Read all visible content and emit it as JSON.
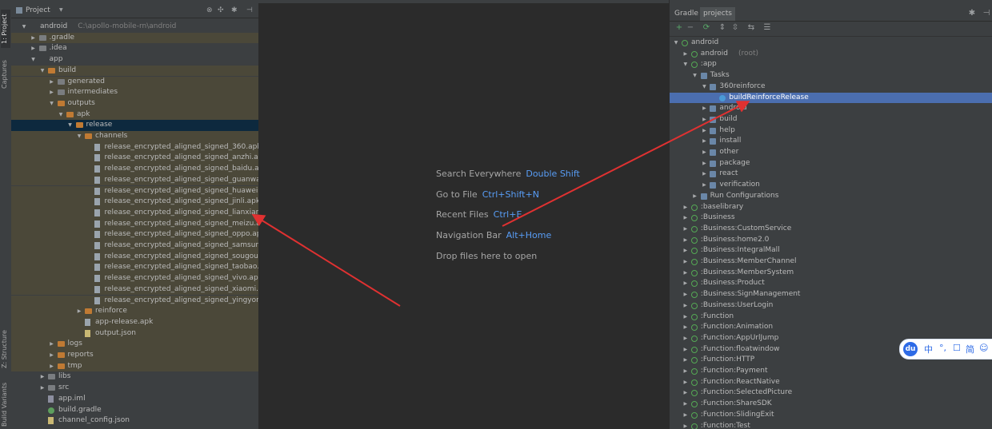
{
  "left_strip": {
    "tabs": [
      "1: Project",
      "Captures",
      "Z: Structure",
      "Build Variants"
    ]
  },
  "project_panel": {
    "title": "Project",
    "toolbar_icons": [
      "target-icon",
      "collapse-icon",
      "gear-icon",
      "hide-icon"
    ],
    "tree": [
      {
        "depth": 0,
        "expanded": true,
        "icon": "module",
        "label": "android",
        "sub": "C:\\apollo-mobile-rn\\android"
      },
      {
        "depth": 1,
        "expanded": false,
        "icon": "folder",
        "label": ".gradle",
        "state": "tan"
      },
      {
        "depth": 1,
        "expanded": false,
        "icon": "folder",
        "label": ".idea"
      },
      {
        "depth": 1,
        "expanded": true,
        "icon": "module",
        "label": "app"
      },
      {
        "depth": 2,
        "expanded": true,
        "icon": "ofolder",
        "label": "build",
        "state": "tan"
      },
      {
        "depth": 3,
        "expanded": false,
        "icon": "folder",
        "label": "generated",
        "state": "tan"
      },
      {
        "depth": 3,
        "expanded": false,
        "icon": "folder",
        "label": "intermediates",
        "state": "tan"
      },
      {
        "depth": 3,
        "expanded": true,
        "icon": "ofolder",
        "label": "outputs",
        "state": "tan"
      },
      {
        "depth": 4,
        "expanded": true,
        "icon": "ofolder",
        "label": "apk",
        "state": "tan"
      },
      {
        "depth": 5,
        "expanded": true,
        "icon": "ofolder",
        "label": "release",
        "state": "selected"
      },
      {
        "depth": 6,
        "expanded": true,
        "icon": "ofolder",
        "label": "channels",
        "state": "tan"
      },
      {
        "depth": 7,
        "icon": "file",
        "label": "release_encrypted_aligned_signed_360.apk",
        "state": "tan"
      },
      {
        "depth": 7,
        "icon": "file",
        "label": "release_encrypted_aligned_signed_anzhi.apk",
        "state": "tan"
      },
      {
        "depth": 7,
        "icon": "file",
        "label": "release_encrypted_aligned_signed_baidu.apk",
        "state": "tan"
      },
      {
        "depth": 7,
        "icon": "file",
        "label": "release_encrypted_aligned_signed_guanwang.apk",
        "state": "tan"
      },
      {
        "depth": 7,
        "icon": "file",
        "label": "release_encrypted_aligned_signed_huawei.apk",
        "state": "tan"
      },
      {
        "depth": 7,
        "icon": "file",
        "label": "release_encrypted_aligned_signed_jinli.apk",
        "state": "tan"
      },
      {
        "depth": 7,
        "icon": "file",
        "label": "release_encrypted_aligned_signed_lianxiang.apk",
        "state": "tan"
      },
      {
        "depth": 7,
        "icon": "file",
        "label": "release_encrypted_aligned_signed_meizu.apk",
        "state": "tan"
      },
      {
        "depth": 7,
        "icon": "file",
        "label": "release_encrypted_aligned_signed_oppo.apk",
        "state": "tan"
      },
      {
        "depth": 7,
        "icon": "file",
        "label": "release_encrypted_aligned_signed_samsung.apk",
        "state": "tan"
      },
      {
        "depth": 7,
        "icon": "file",
        "label": "release_encrypted_aligned_signed_sougou.apk",
        "state": "tan"
      },
      {
        "depth": 7,
        "icon": "file",
        "label": "release_encrypted_aligned_signed_taobao.apk",
        "state": "tan"
      },
      {
        "depth": 7,
        "icon": "file",
        "label": "release_encrypted_aligned_signed_vivo.apk",
        "state": "tan"
      },
      {
        "depth": 7,
        "icon": "file",
        "label": "release_encrypted_aligned_signed_xiaomi.apk",
        "state": "tan"
      },
      {
        "depth": 7,
        "icon": "file",
        "label": "release_encrypted_aligned_signed_yingyongbao.apk",
        "state": "tan"
      },
      {
        "depth": 6,
        "expanded": false,
        "icon": "ofolder",
        "label": "reinforce",
        "state": "tan"
      },
      {
        "depth": 6,
        "icon": "file",
        "label": "app-release.apk",
        "state": "tan"
      },
      {
        "depth": 6,
        "icon": "json",
        "label": "output.json",
        "state": "tan"
      },
      {
        "depth": 3,
        "expanded": false,
        "icon": "ofolder",
        "label": "logs",
        "state": "tan"
      },
      {
        "depth": 3,
        "expanded": false,
        "icon": "ofolder",
        "label": "reports",
        "state": "tan"
      },
      {
        "depth": 3,
        "expanded": false,
        "icon": "ofolder",
        "label": "tmp",
        "state": "tan"
      },
      {
        "depth": 2,
        "expanded": false,
        "icon": "folder",
        "label": "libs"
      },
      {
        "depth": 2,
        "expanded": false,
        "icon": "folder",
        "label": "src"
      },
      {
        "depth": 2,
        "icon": "iml",
        "label": "app.iml"
      },
      {
        "depth": 2,
        "icon": "gr",
        "label": "build.gradle"
      },
      {
        "depth": 2,
        "icon": "json",
        "label": "channel_config.json"
      }
    ]
  },
  "editor": {
    "hints": [
      {
        "text": "Search Everywhere",
        "key": "Double Shift"
      },
      {
        "text": "Go to File",
        "key": "Ctrl+Shift+N"
      },
      {
        "text": "Recent Files",
        "key": "Ctrl+E"
      },
      {
        "text": "Navigation Bar",
        "key": "Alt+Home"
      },
      {
        "text": "Drop files here to open",
        "key": ""
      }
    ]
  },
  "gradle_panel": {
    "tabs": [
      "Gradle",
      "projects"
    ],
    "toolbar_icons": [
      "add-icon",
      "remove-icon",
      "refresh-icon",
      "expand-all-icon",
      "collapse-all-icon",
      "link-icon",
      "settings-icon"
    ],
    "tree": [
      {
        "depth": 0,
        "expanded": true,
        "icon": "gradle",
        "label": "android"
      },
      {
        "depth": 1,
        "expanded": false,
        "icon": "gradle",
        "label": "android",
        "sub": "(root)"
      },
      {
        "depth": 1,
        "expanded": true,
        "icon": "gradle",
        "label": ":app"
      },
      {
        "depth": 2,
        "expanded": true,
        "icon": "folder",
        "label": "Tasks"
      },
      {
        "depth": 3,
        "expanded": true,
        "icon": "folder",
        "label": "360reinforce"
      },
      {
        "depth": 4,
        "icon": "gear",
        "label": "buildReinforceRelease",
        "state": "selected"
      },
      {
        "depth": 3,
        "expanded": false,
        "icon": "folder",
        "label": "android"
      },
      {
        "depth": 3,
        "expanded": false,
        "icon": "folder",
        "label": "build"
      },
      {
        "depth": 3,
        "expanded": false,
        "icon": "folder",
        "label": "help"
      },
      {
        "depth": 3,
        "expanded": false,
        "icon": "folder",
        "label": "install"
      },
      {
        "depth": 3,
        "expanded": false,
        "icon": "folder",
        "label": "other"
      },
      {
        "depth": 3,
        "expanded": false,
        "icon": "folder",
        "label": "package"
      },
      {
        "depth": 3,
        "expanded": false,
        "icon": "folder",
        "label": "react"
      },
      {
        "depth": 3,
        "expanded": false,
        "icon": "folder",
        "label": "verification"
      },
      {
        "depth": 2,
        "expanded": false,
        "icon": "cfg",
        "label": "Run Configurations"
      },
      {
        "depth": 1,
        "expanded": false,
        "icon": "gradle",
        "label": ":baselibrary"
      },
      {
        "depth": 1,
        "expanded": false,
        "icon": "gradle",
        "label": ":Business"
      },
      {
        "depth": 1,
        "expanded": false,
        "icon": "gradle",
        "label": ":Business:CustomService"
      },
      {
        "depth": 1,
        "expanded": false,
        "icon": "gradle",
        "label": ":Business:home2.0"
      },
      {
        "depth": 1,
        "expanded": false,
        "icon": "gradle",
        "label": ":Business:IntegralMall"
      },
      {
        "depth": 1,
        "expanded": false,
        "icon": "gradle",
        "label": ":Business:MemberChannel"
      },
      {
        "depth": 1,
        "expanded": false,
        "icon": "gradle",
        "label": ":Business:MemberSystem"
      },
      {
        "depth": 1,
        "expanded": false,
        "icon": "gradle",
        "label": ":Business:Product"
      },
      {
        "depth": 1,
        "expanded": false,
        "icon": "gradle",
        "label": ":Business:SignManagement"
      },
      {
        "depth": 1,
        "expanded": false,
        "icon": "gradle",
        "label": ":Business:UserLogin"
      },
      {
        "depth": 1,
        "expanded": false,
        "icon": "gradle",
        "label": ":Function"
      },
      {
        "depth": 1,
        "expanded": false,
        "icon": "gradle",
        "label": ":Function:Animation"
      },
      {
        "depth": 1,
        "expanded": false,
        "icon": "gradle",
        "label": ":Function:AppUrlJump"
      },
      {
        "depth": 1,
        "expanded": false,
        "icon": "gradle",
        "label": ":Function:floatwindow"
      },
      {
        "depth": 1,
        "expanded": false,
        "icon": "gradle",
        "label": ":Function:HTTP"
      },
      {
        "depth": 1,
        "expanded": false,
        "icon": "gradle",
        "label": ":Function:Payment"
      },
      {
        "depth": 1,
        "expanded": false,
        "icon": "gradle",
        "label": ":Function:ReactNative"
      },
      {
        "depth": 1,
        "expanded": false,
        "icon": "gradle",
        "label": ":Function:SelectedPicture"
      },
      {
        "depth": 1,
        "expanded": false,
        "icon": "gradle",
        "label": ":Function:ShareSDK"
      },
      {
        "depth": 1,
        "expanded": false,
        "icon": "gradle",
        "label": ":Function:SlidingExit"
      },
      {
        "depth": 1,
        "expanded": false,
        "icon": "gradle",
        "label": ":Function:Test"
      }
    ]
  },
  "ime_toolbar": {
    "logo": "du",
    "items": [
      "中",
      "°,",
      "☐",
      "简",
      "☺"
    ]
  },
  "colors": {
    "selection_blue": "#4b6eaf",
    "project_selection": "#0d293e",
    "build_dir_tint": "#4b4839",
    "annotation_arrow": "#e03131",
    "shortcut_blue": "#589df6"
  }
}
